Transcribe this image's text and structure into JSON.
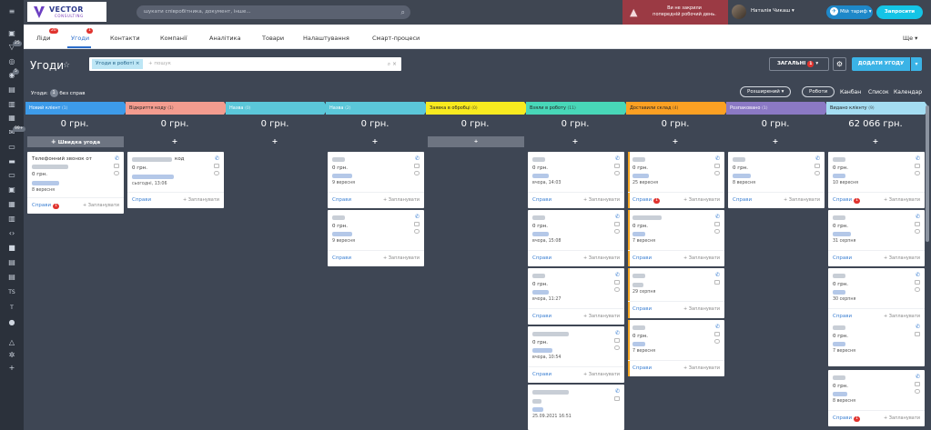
{
  "header": {
    "logo_text": "VECTOR",
    "logo_sub": "CONSULTING",
    "search_placeholder": "шукати співробітника, документ, інше...",
    "warning_line1": "Ви не закрили",
    "warning_line2": "попередній робочий день.",
    "user_name": "Наталія Чикаш",
    "plan_label": "Мій тариф",
    "invite_label": "Запросити"
  },
  "rail_badges": {
    "b1": "25",
    "b2": "5",
    "b3": "99+"
  },
  "rail_text": {
    "ts": "TS",
    "t": "T"
  },
  "nav": {
    "tabs": [
      {
        "label": "Ліди",
        "badge": "20"
      },
      {
        "label": "Угоди",
        "badge": "1"
      },
      {
        "label": "Контакти"
      },
      {
        "label": "Компанії"
      },
      {
        "label": "Аналітика"
      },
      {
        "label": "Товари"
      },
      {
        "label": "Налаштування"
      },
      {
        "label": "Смарт-процеси"
      }
    ],
    "more_label": "Ще"
  },
  "page": {
    "title": "Угоди",
    "filter_chip": "Угоди в роботі",
    "filter_placeholder": "+ пошук",
    "general_label": "ЗАГАЛЬНІ",
    "general_badge": "1",
    "add_deal_label": "ДОДАТИ УГОДУ"
  },
  "subbar": {
    "deals_label": "Угоди:",
    "deals_count": "1",
    "deals_suffix": "без справ",
    "extended_label": "Розширений",
    "robots_label": "Роботи",
    "views": [
      "Канбан",
      "Список",
      "Календар"
    ]
  },
  "colors": {
    "stage_new": "#3d9be9",
    "stage_code": "#f39c8f",
    "stage_name": "#5bc7d9",
    "stage_processing": "#f8ea1f",
    "stage_taken": "#48d7b8",
    "stage_delivered": "#fba023",
    "stage_unpacked": "#8b79c4",
    "stage_issued": "#a4ddf2"
  },
  "board": {
    "quick_deal_label": "Швидка угода",
    "plan_label": "+ Запланувати",
    "affairs_label": "Справи",
    "columns": [
      {
        "title": "Новий клієнт",
        "count": "(1)",
        "sum": "0 грн."
      },
      {
        "title": "Відкриття коду",
        "count": "(1)",
        "sum": "0 грн."
      },
      {
        "title": "Назва",
        "count": "(0)",
        "sum": "0 грн."
      },
      {
        "title": "Назва",
        "count": "(2)",
        "sum": "0 грн."
      },
      {
        "title": "Заявка в обробці",
        "count": "(0)",
        "sum": "0 грн."
      },
      {
        "title": "Взяли в роботу",
        "count": "(11)",
        "sum": "0 грн."
      },
      {
        "title": "Доставили склад",
        "count": "(4)",
        "sum": "0 грн."
      },
      {
        "title": "Розпаковано",
        "count": "(1)",
        "sum": "0 грн."
      },
      {
        "title": "Видано клієнту",
        "count": "(9)",
        "sum": "62 066 грн."
      }
    ],
    "cards": {
      "c0_title": "Телефонний звонок от",
      "c0_amount": "0 грн.",
      "c0_date": "8 вересня",
      "c0_badge": "1",
      "c1_title": "код",
      "c1_amount": "0 грн.",
      "c1_date": "сьогодні, 13:06",
      "c3a_amount": "0 грн.",
      "c3a_date": "9 вересня",
      "c3b_amount": "0 грн.",
      "c3b_date": "9 вересня",
      "c5a_amount": "0 грн.",
      "c5a_date": "вчора, 14:03",
      "c5b_amount": "0 грн.",
      "c5b_date": "вчора, 15:08",
      "c5c_amount": "0 грн.",
      "c5c_date": "вчора, 11:27",
      "c5d_amount": "0 грн.",
      "c5d_date": "вчора, 10:54",
      "c5e_amount": "0 грн.",
      "c5e_date": "25.09.2021 16:51",
      "c6a_amount": "0 грн.",
      "c6a_date": "25 вересня",
      "c6a_badge": "1",
      "c6b_amount": "0 грн.",
      "c6b_date": "7 вересня",
      "c6c_date": "29 серпня",
      "c6d_amount": "0 грн.",
      "c6d_date": "7 вересня",
      "c7_amount": "0 грн.",
      "c7_date": "8 вересня",
      "c8a_amount": "0 грн.",
      "c8a_date": "10 вересня",
      "c8a_badge": "1",
      "c8b_amount": "0 грн.",
      "c8b_date": "31 серпня",
      "c8c_amount": "0 грн.",
      "c8c_date": "30 серпня",
      "c8d_amount": "0 грн.",
      "c8d_date": "7 вересня",
      "c8e_amount": "0 грн.",
      "c8e_date": "8 вересня",
      "c8e_badge": "1"
    }
  }
}
